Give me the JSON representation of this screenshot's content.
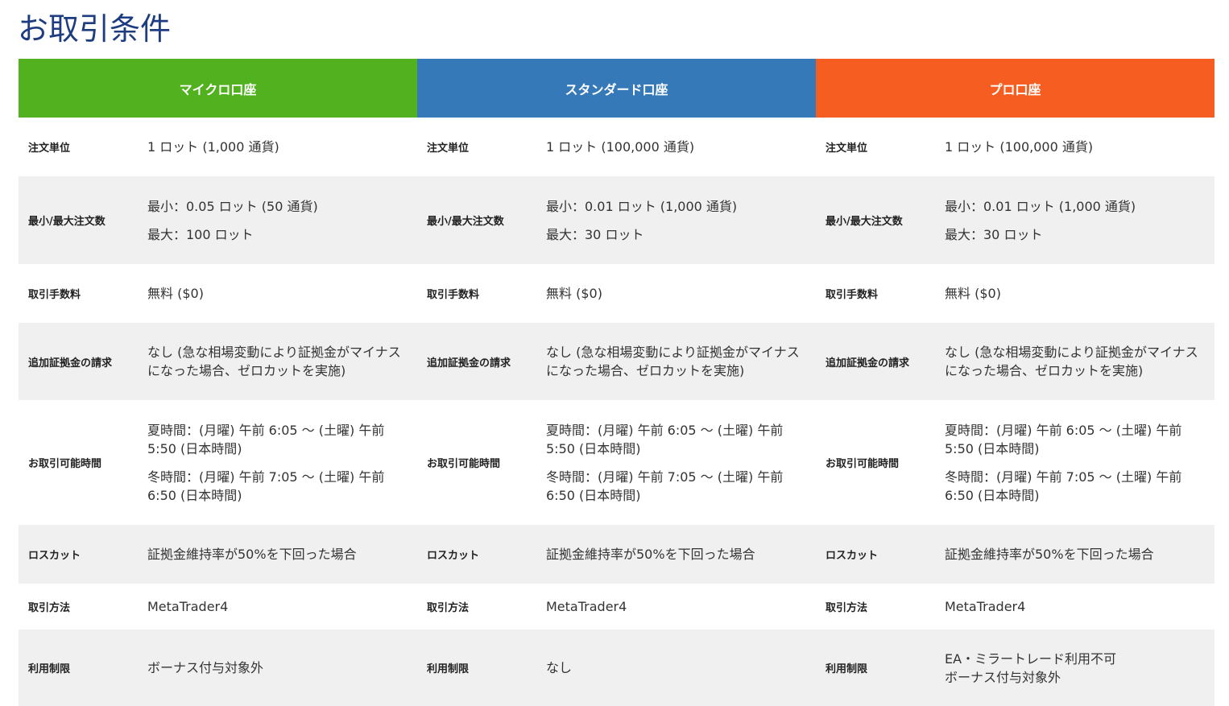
{
  "page": {
    "title": "お取引条件"
  },
  "accounts": [
    {
      "name": "マイクロ口座",
      "color": "#52b11f"
    },
    {
      "name": "スタンダード口座",
      "color": "#3679b8"
    },
    {
      "name": "プロ口座",
      "color": "#f55e20"
    }
  ],
  "rows": [
    {
      "label": "注文単位",
      "values": [
        [
          "1 ロット (1,000 通貨)"
        ],
        [
          "1 ロット (100,000 通貨)"
        ],
        [
          "1 ロット (100,000 通貨)"
        ]
      ]
    },
    {
      "label": "最小/最大注文数",
      "values": [
        [
          "最小：0.05 ロット (50 通貨)",
          "最大：100 ロット"
        ],
        [
          "最小：0.01 ロット (1,000 通貨)",
          "最大：30 ロット"
        ],
        [
          "最小：0.01 ロット (1,000 通貨)",
          "最大：30 ロット"
        ]
      ]
    },
    {
      "label": "取引手数料",
      "values": [
        [
          "無料 ($0)"
        ],
        [
          "無料 ($0)"
        ],
        [
          "無料 ($0)"
        ]
      ]
    },
    {
      "label": "追加証拠金の請求",
      "values": [
        [
          "なし (急な相場変動により証拠金がマイナスになった場合、ゼロカットを実施)"
        ],
        [
          "なし (急な相場変動により証拠金がマイナスになった場合、ゼロカットを実施)"
        ],
        [
          "なし (急な相場変動により証拠金がマイナスになった場合、ゼロカットを実施)"
        ]
      ]
    },
    {
      "label": "お取引可能時間",
      "values": [
        [
          "夏時間：(月曜) 午前 6:05 〜 (土曜) 午前 5:50 (日本時間)",
          "冬時間：(月曜) 午前 7:05 〜 (土曜) 午前 6:50 (日本時間)"
        ],
        [
          "夏時間：(月曜) 午前 6:05 〜 (土曜) 午前 5:50 (日本時間)",
          "冬時間：(月曜) 午前 7:05 〜 (土曜) 午前 6:50 (日本時間)"
        ],
        [
          "夏時間：(月曜) 午前 6:05 〜 (土曜) 午前 5:50 (日本時間)",
          "冬時間：(月曜) 午前 7:05 〜 (土曜) 午前 6:50 (日本時間)"
        ]
      ]
    },
    {
      "label": "ロスカット",
      "values": [
        [
          "証拠金維持率が50%を下回った場合"
        ],
        [
          "証拠金維持率が50%を下回った場合"
        ],
        [
          "証拠金維持率が50%を下回った場合"
        ]
      ]
    },
    {
      "label": "取引方法",
      "values": [
        [
          "MetaTrader4"
        ],
        [
          "MetaTrader4"
        ],
        [
          "MetaTrader4"
        ]
      ]
    },
    {
      "label": "利用制限",
      "values": [
        [
          "ボーナス付与対象外"
        ],
        [
          "なし"
        ],
        [
          "EA・ミラートレード利用不可",
          "ボーナス付与対象外"
        ]
      ]
    }
  ]
}
